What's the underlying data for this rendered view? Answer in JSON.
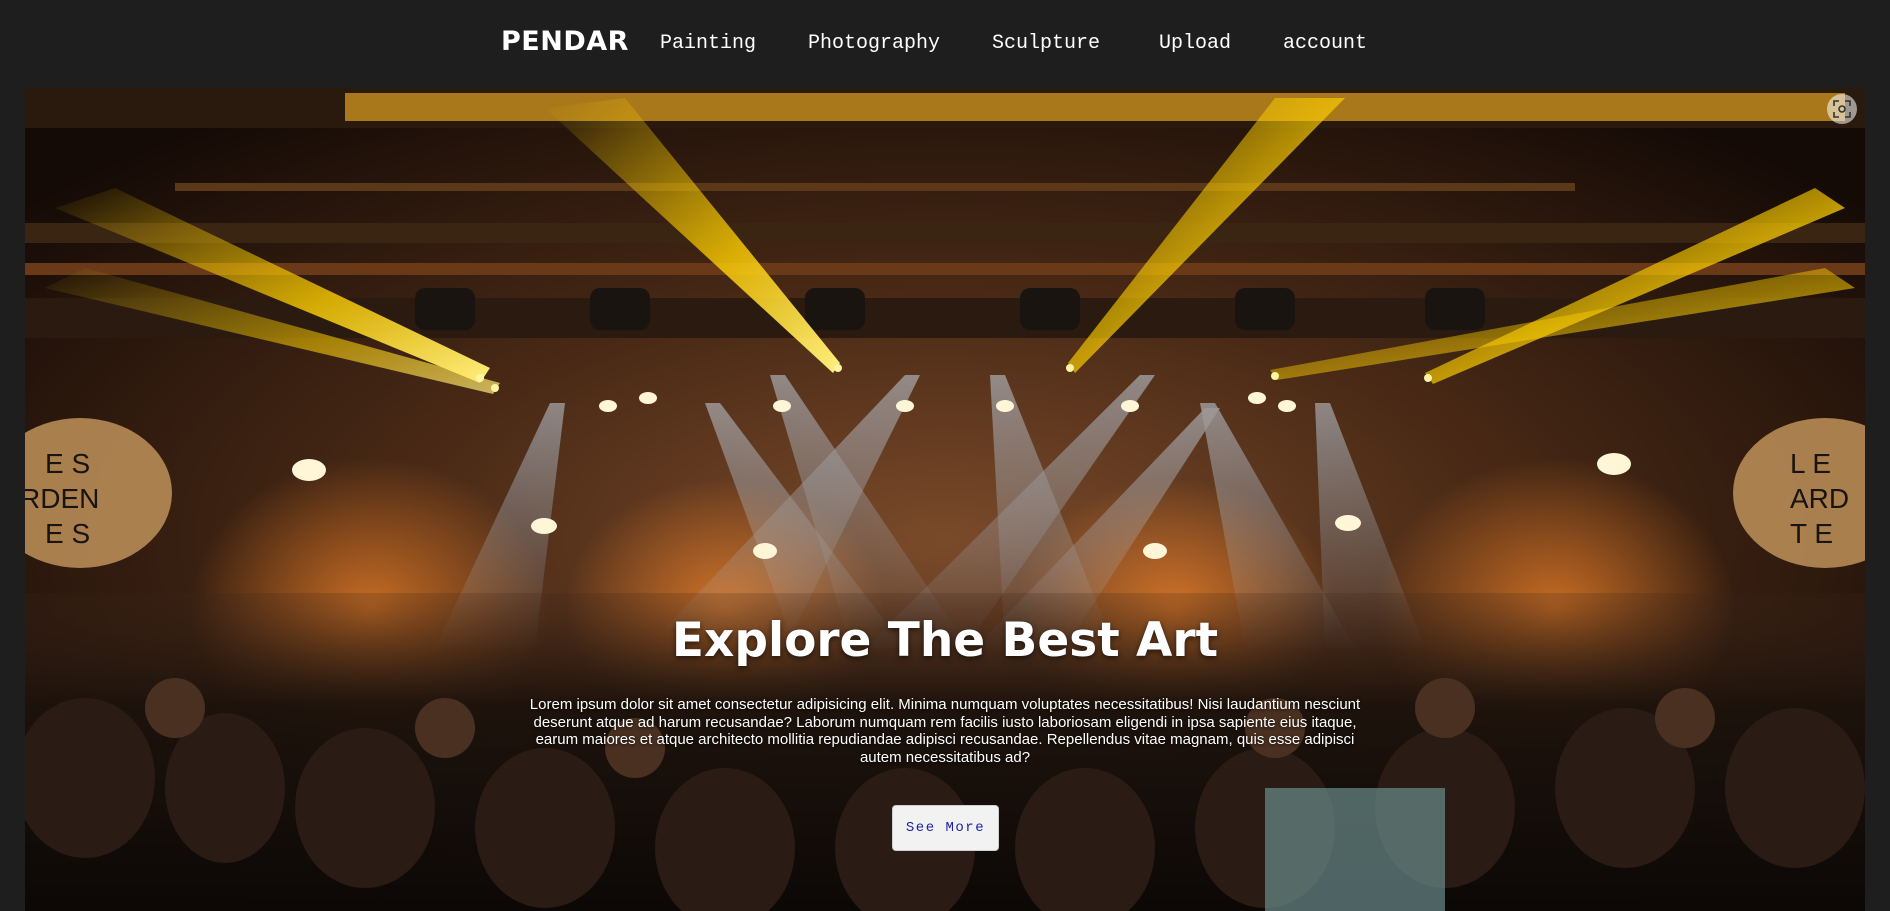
{
  "header": {
    "brand": "PENDAR",
    "nav": [
      {
        "label": "Painting"
      },
      {
        "label": "Photography"
      },
      {
        "label": "Sculpture"
      },
      {
        "label": "Upload"
      },
      {
        "label": "account"
      }
    ]
  },
  "hero": {
    "image_icon": "lens-scan-icon",
    "title": "Explore The Best Art",
    "text": "Lorem ipsum dolor sit amet consectetur adipisicing elit. Minima numquam voluptates necessitatibus! Nisi laudantium nesciunt deserunt atque ad harum recusandae? Laborum numquam rem facilis iusto laboriosam eligendi in ipsa sapiente eius itaque, earum maiores et atque architecto mollitia repudiandae adipisci recusandae. Repellendus vitae magnam, quis esse adipisci autem necessitatibus ad?",
    "button_label": "See More",
    "banner_left": "E S\nRDEN\nE S",
    "banner_right": "L E\nARD\nT E"
  },
  "colors": {
    "background": "#1e1e1e",
    "button_text": "#1a23a0",
    "button_bg": "#f2f2f2"
  }
}
